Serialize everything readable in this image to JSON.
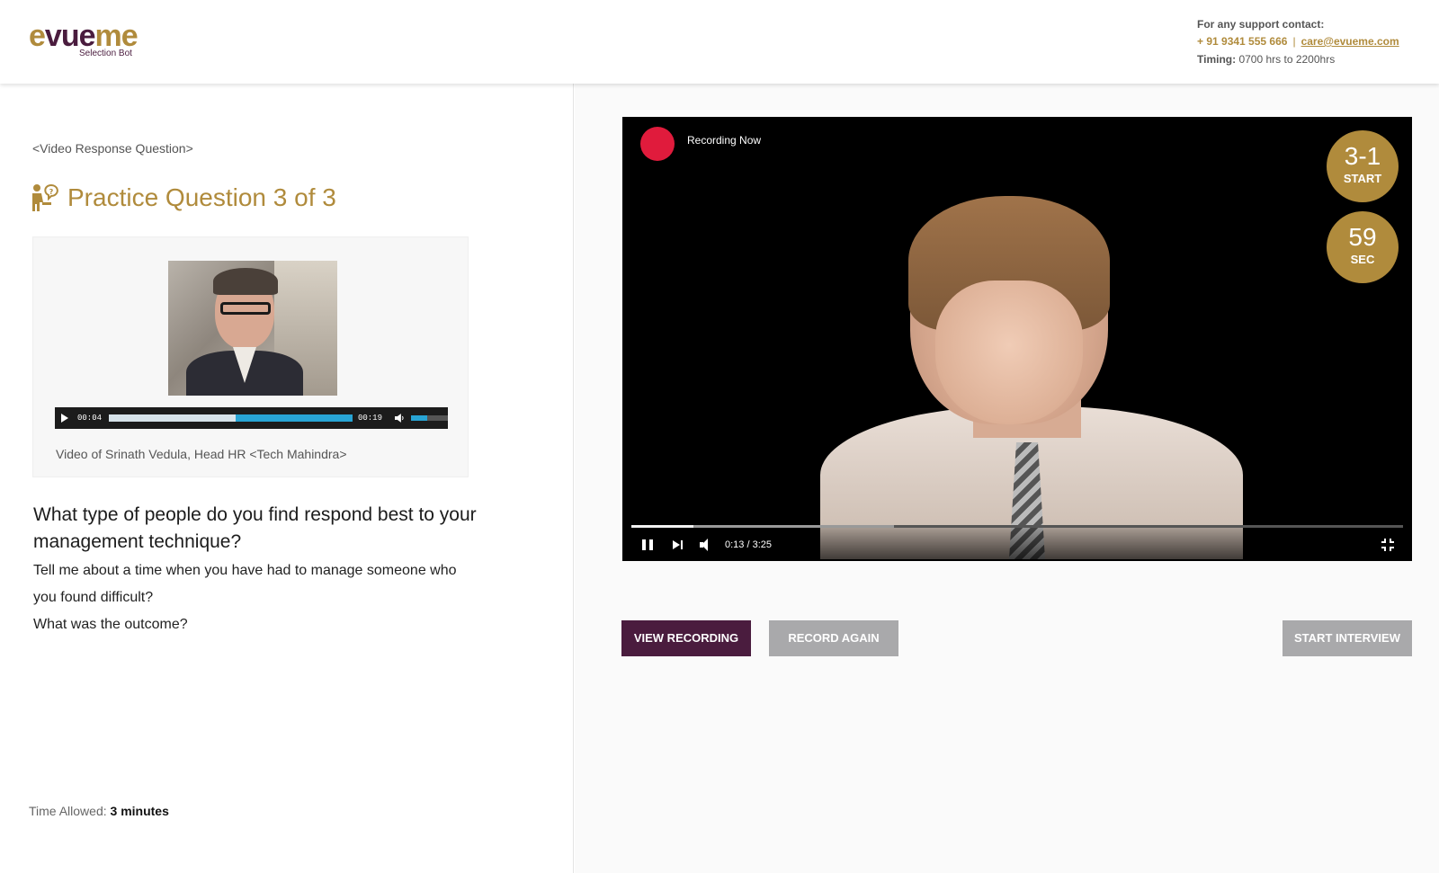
{
  "header": {
    "logo": {
      "part1": "e",
      "part2": "v",
      "part3": "ue",
      "part4": "me",
      "sub": "Selection Bot"
    },
    "support": {
      "title": "For any support contact:",
      "phone": "+ 91 9341 555 666",
      "separator": "|",
      "email": "care@evueme.com",
      "timing_label": "Timing:",
      "timing_value": "0700 hrs to  2200hrs"
    }
  },
  "left": {
    "question_type": "<Video Response Question>",
    "title": "Practice Question 3 of 3",
    "audio_player": {
      "current_time": "00:04",
      "total_time": "00:19",
      "progress": 0.52,
      "volume": 0.45
    },
    "video_caption": "Video of Srinath Vedula, Head HR <Tech Mahindra>",
    "question": "What type of people do you find respond best to your management technique?",
    "details_line1": "Tell me about a time when you have had to manage someone who",
    "details_line2": "you found difficult?",
    "details_line3": "What was the outcome?",
    "time_allowed_label": "Time Allowed:",
    "time_allowed_value": "3 minutes"
  },
  "right": {
    "recording_label": "Recording Now",
    "badge_start": {
      "value": "3-1",
      "label": "START"
    },
    "badge_sec": {
      "value": "59",
      "label": "SEC"
    },
    "video": {
      "time": "0:13 / 3:25",
      "played_fraction": 0.08,
      "buffered_fraction": 0.34
    },
    "buttons": {
      "view": "VIEW RECORDING",
      "again": "RECORD AGAIN",
      "start": "START INTERVIEW"
    }
  },
  "colors": {
    "brand_gold": "#b08b3c",
    "brand_purple": "#4a1c3e",
    "record_red": "#e01b3c",
    "disabled_gray": "#a9a9ab"
  }
}
